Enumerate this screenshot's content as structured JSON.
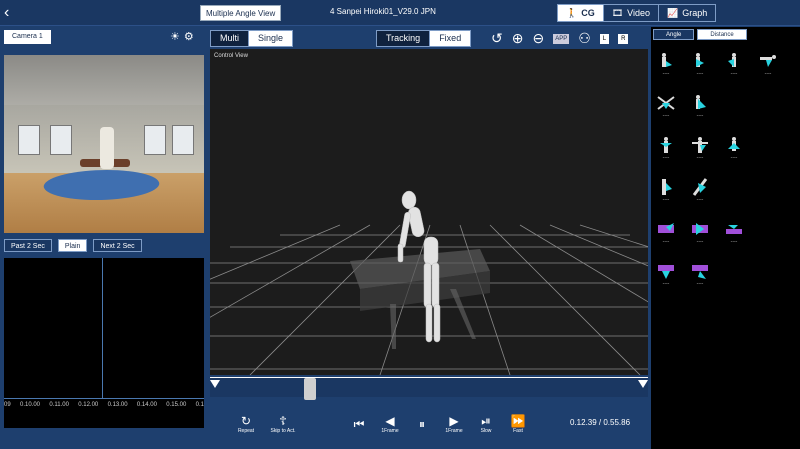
{
  "header": {
    "back": "‹",
    "mode_button": "Multiple Angle View",
    "file_title": "4 Sanpei Hiroki01_V29.0 JPN",
    "view_tabs": [
      {
        "label": "CG",
        "icon": "person-icon",
        "active": true
      },
      {
        "label": "Video",
        "icon": "film-icon",
        "active": false
      },
      {
        "label": "Graph",
        "icon": "graph-icon",
        "active": false
      }
    ]
  },
  "left": {
    "camera_label": "Camera 1",
    "time_buttons": [
      "Past 2 Sec",
      "Plain",
      "Next 2 Sec"
    ],
    "active_time_button": "Plain",
    "axis_labels": [
      "09",
      "0.10.00",
      "0.11.00",
      "0.12.00",
      "0.13.00",
      "0.14.00",
      "0.15.00",
      "0.1"
    ]
  },
  "center": {
    "view_mode": [
      "Multi",
      "Single"
    ],
    "active_view_mode": "Multi",
    "track_mode": [
      "Tracking",
      "Fixed"
    ],
    "active_track_mode": "Fixed",
    "app_badge": "APP",
    "left_badge": "L",
    "right_badge": "R",
    "viewport_label": "Control View",
    "controls": [
      {
        "label": "Repeat",
        "glyph": "↻",
        "icon": "repeat-icon"
      },
      {
        "label": "Skip to Act.",
        "glyph": "☦",
        "icon": "skip-to-act-icon"
      },
      {
        "label": "",
        "glyph": "⏮",
        "icon": "jump-start-icon"
      },
      {
        "label": "1Frame",
        "glyph": "◀",
        "icon": "frame-back-icon"
      },
      {
        "label": "",
        "glyph": "⏸",
        "icon": "pause-icon"
      },
      {
        "label": "1Frame",
        "glyph": "▶",
        "icon": "frame-forward-icon"
      },
      {
        "label": "Slow",
        "glyph": "⏯",
        "icon": "slow-icon"
      },
      {
        "label": "Fast",
        "glyph": "⏩",
        "icon": "fast-icon"
      }
    ],
    "time_readout": "0.12.39 / 0.55.86",
    "playback_position": 0.22
  },
  "right": {
    "tabs": [
      "Angle",
      "Distance"
    ],
    "active_tab": "Angle",
    "value_placeholder": "----"
  },
  "colors": {
    "bg": "#1e3f6e",
    "accent": "#7e9cc6",
    "icon_cyan": "#29d3e0",
    "icon_purple": "#a04fd9"
  }
}
